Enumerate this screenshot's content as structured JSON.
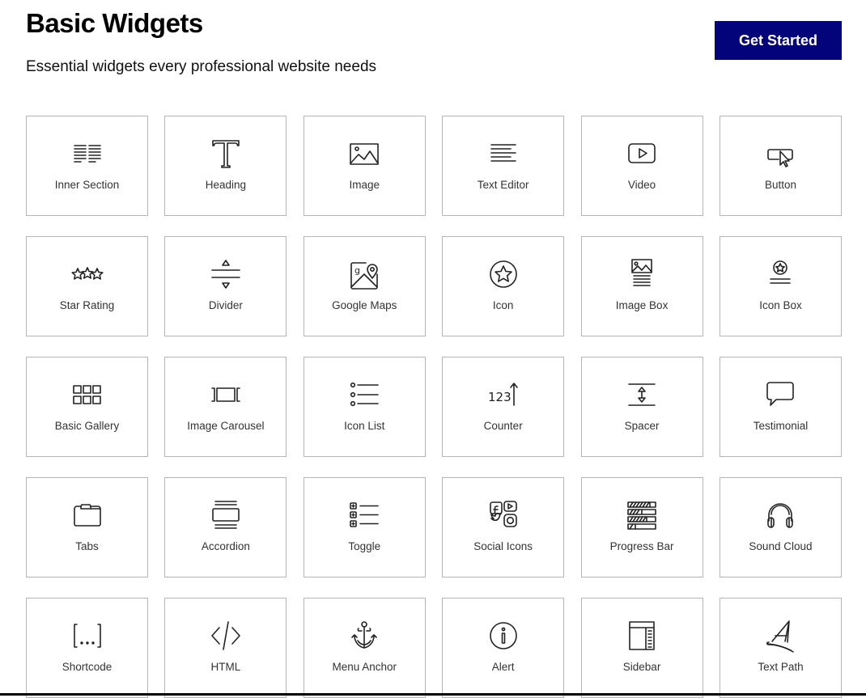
{
  "header": {
    "title": "Basic Widgets",
    "subtitle": "Essential widgets every professional website needs",
    "cta_label": "Get Started"
  },
  "colors": {
    "cta_background": "#04047a",
    "card_border": "#b5b5b5"
  },
  "widgets": [
    {
      "label": "Inner Section",
      "icon": "inner-section-icon"
    },
    {
      "label": "Heading",
      "icon": "heading-icon"
    },
    {
      "label": "Image",
      "icon": "image-icon"
    },
    {
      "label": "Text Editor",
      "icon": "text-editor-icon"
    },
    {
      "label": "Video",
      "icon": "video-icon"
    },
    {
      "label": "Button",
      "icon": "button-icon"
    },
    {
      "label": "Star Rating",
      "icon": "star-rating-icon"
    },
    {
      "label": "Divider",
      "icon": "divider-icon"
    },
    {
      "label": "Google Maps",
      "icon": "google-maps-icon"
    },
    {
      "label": "Icon",
      "icon": "star-circle-icon"
    },
    {
      "label": "Image Box",
      "icon": "image-box-icon"
    },
    {
      "label": "Icon Box",
      "icon": "icon-box-icon"
    },
    {
      "label": "Basic Gallery",
      "icon": "gallery-grid-icon"
    },
    {
      "label": "Image Carousel",
      "icon": "carousel-icon"
    },
    {
      "label": "Icon List",
      "icon": "icon-list-icon"
    },
    {
      "label": "Counter",
      "icon": "counter-icon"
    },
    {
      "label": "Spacer",
      "icon": "spacer-icon"
    },
    {
      "label": "Testimonial",
      "icon": "speech-bubble-icon"
    },
    {
      "label": "Tabs",
      "icon": "tabs-folder-icon"
    },
    {
      "label": "Accordion",
      "icon": "accordion-icon"
    },
    {
      "label": "Toggle",
      "icon": "toggle-list-icon"
    },
    {
      "label": "Social Icons",
      "icon": "social-icons-icon"
    },
    {
      "label": "Progress Bar",
      "icon": "progress-bars-icon"
    },
    {
      "label": "Sound Cloud",
      "icon": "headphones-icon"
    },
    {
      "label": "Shortcode",
      "icon": "shortcode-brackets-icon"
    },
    {
      "label": "HTML",
      "icon": "code-icon"
    },
    {
      "label": "Menu Anchor",
      "icon": "anchor-icon"
    },
    {
      "label": "Alert",
      "icon": "info-circle-icon"
    },
    {
      "label": "Sidebar",
      "icon": "sidebar-layout-icon"
    },
    {
      "label": "Text Path",
      "icon": "text-path-icon"
    }
  ]
}
